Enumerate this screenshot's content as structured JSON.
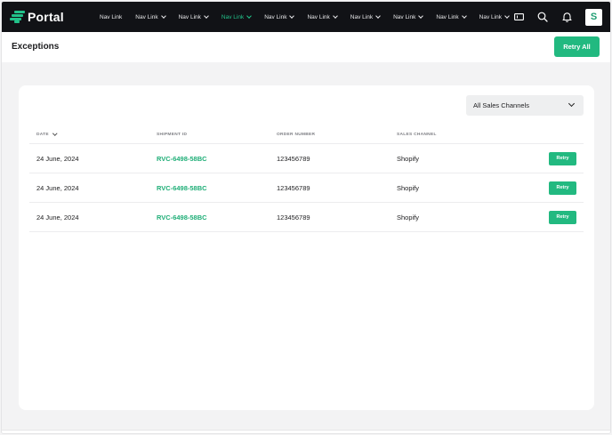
{
  "app": {
    "logo_text": "Portal"
  },
  "nav": {
    "links": [
      {
        "label": "Nav Link",
        "has_dropdown": false,
        "active": false
      },
      {
        "label": "Nav Link",
        "has_dropdown": true,
        "active": false
      },
      {
        "label": "Nav Link",
        "has_dropdown": true,
        "active": false
      },
      {
        "label": "Nav Link",
        "has_dropdown": true,
        "active": true
      },
      {
        "label": "Nav Link",
        "has_dropdown": true,
        "active": false
      },
      {
        "label": "Nav Link",
        "has_dropdown": true,
        "active": false
      },
      {
        "label": "Nav Link",
        "has_dropdown": true,
        "active": false
      },
      {
        "label": "Nav Link",
        "has_dropdown": true,
        "active": false
      },
      {
        "label": "Nav Link",
        "has_dropdown": true,
        "active": false
      },
      {
        "label": "Nav Link",
        "has_dropdown": true,
        "active": false
      }
    ],
    "icons": [
      "ticket-icon",
      "search-icon",
      "bell-icon"
    ],
    "avatar_letter": "S"
  },
  "header": {
    "title": "Exceptions",
    "retry_all_label": "Retry All"
  },
  "filter": {
    "selected": "All Sales Channels"
  },
  "table": {
    "columns": [
      "DATE",
      "SHIPMENT ID",
      "ORDER NUMBER",
      "SALES CHANNEL"
    ],
    "retry_label": "Retry",
    "rows": [
      {
        "date": "24 June, 2024",
        "shipment_id": "RVC-6498-58BC",
        "order_number": "123456789",
        "sales_channel": "Shopify"
      },
      {
        "date": "24 June, 2024",
        "shipment_id": "RVC-6498-58BC",
        "order_number": "123456789",
        "sales_channel": "Shopify"
      },
      {
        "date": "24 June, 2024",
        "shipment_id": "RVC-6498-58BC",
        "order_number": "123456789",
        "sales_channel": "Shopify"
      }
    ]
  },
  "colors": {
    "accent": "#22b980",
    "nav_bg": "#111216",
    "link": "#1fae77"
  }
}
